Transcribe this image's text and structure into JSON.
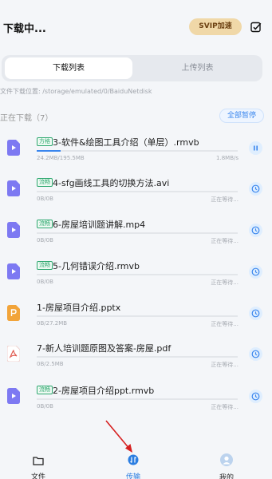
{
  "header": {
    "title": "下载中...",
    "svip_label": "SVIP加速"
  },
  "tabs": [
    {
      "label": "下载列表",
      "active": true
    },
    {
      "label": "上传列表",
      "active": false
    }
  ],
  "save_path": "文件下载位置: /storage/emulated/0/BaiduNetdisk",
  "section": {
    "label": "正在下载（7）",
    "pause_all_label": "全部暂停"
  },
  "downloads": [
    {
      "badge": "方格",
      "name": "3-软件&绘图工具介绍（单层）.rmvb",
      "size": "24.2MB/195.5MB",
      "status": "1.8MB/s",
      "progress": 0.12,
      "type": "video",
      "action": "pause"
    },
    {
      "badge": "流畅",
      "name": "4-sfg画线工具的切换方法.avi",
      "size": "0B/0B",
      "status": "正在等待...",
      "progress": 0,
      "type": "video",
      "action": "waiting"
    },
    {
      "badge": "流畅",
      "name": "6-房屋培训题讲解.mp4",
      "size": "0B/0B",
      "status": "正在等待...",
      "progress": 0,
      "type": "video",
      "action": "waiting"
    },
    {
      "badge": "流畅",
      "name": "5-几何错误介绍.rmvb",
      "size": "0B/0B",
      "status": "正在等待...",
      "progress": 0,
      "type": "video",
      "action": "waiting"
    },
    {
      "badge": "",
      "name": "1-房屋项目介绍.pptx",
      "size": "0B/27.2MB",
      "status": "正在等待...",
      "progress": 0,
      "type": "ppt",
      "action": "waiting"
    },
    {
      "badge": "",
      "name": "7-新人培训题原图及答案-房屋.pdf",
      "size": "0B/2.5MB",
      "status": "正在等待...",
      "progress": 0,
      "type": "pdf",
      "action": "waiting"
    },
    {
      "badge": "流畅",
      "name": "2-房屋项目介绍ppt.rmvb",
      "size": "0B/0B",
      "status": "正在等待...",
      "progress": 0,
      "type": "video",
      "action": "waiting"
    }
  ],
  "bottom_nav": [
    {
      "label": "文件",
      "icon": "folder-icon",
      "active": false
    },
    {
      "label": "传输",
      "icon": "transfer-icon",
      "active": true
    },
    {
      "label": "我的",
      "icon": "avatar-icon",
      "active": false
    }
  ],
  "colors": {
    "accent": "#3a86ee",
    "svip_bg": "#f0d8a8",
    "video_icon": "#7d79f2",
    "ppt_icon": "#f2a43a",
    "pdf_icon": "#e05a4f",
    "badge_green": "#2fa870",
    "annotation_arrow": "#d62020"
  }
}
